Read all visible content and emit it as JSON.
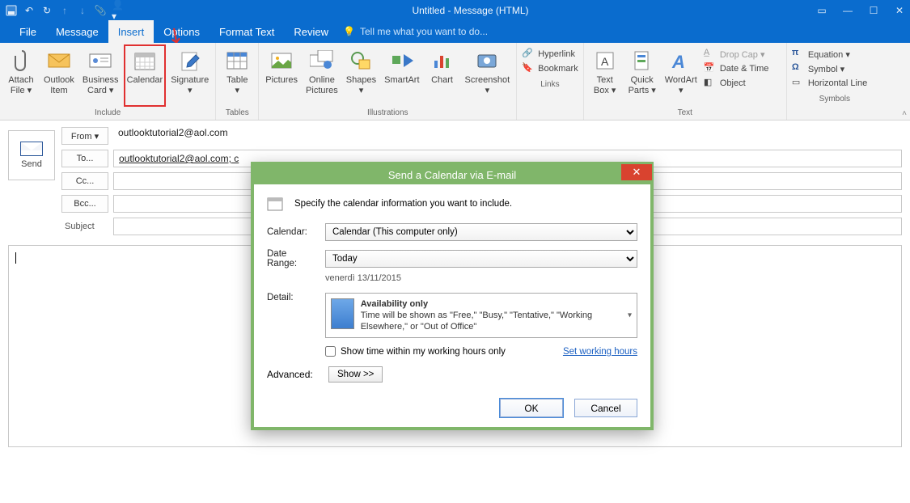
{
  "window": {
    "title": "Untitled - Message (HTML)"
  },
  "menubar": {
    "file": "File",
    "message": "Message",
    "insert": "Insert",
    "options": "Options",
    "format": "Format Text",
    "review": "Review",
    "tell": "Tell me what you want to do..."
  },
  "ribbon": {
    "include": {
      "label": "Include",
      "attach_file": "Attach\nFile ▾",
      "outlook_item": "Outlook\nItem",
      "business_card": "Business\nCard ▾",
      "calendar": "Calendar",
      "signature": "Signature\n▾"
    },
    "tables": {
      "label": "Tables",
      "table": "Table\n▾"
    },
    "illustrations": {
      "label": "Illustrations",
      "pictures": "Pictures",
      "online_pictures": "Online\nPictures",
      "shapes": "Shapes\n▾",
      "smartart": "SmartArt",
      "chart": "Chart",
      "screenshot": "Screenshot\n▾"
    },
    "links": {
      "label": "Links",
      "hyperlink": "Hyperlink",
      "bookmark": "Bookmark"
    },
    "text": {
      "label": "Text",
      "textbox": "Text\nBox ▾",
      "quick_parts": "Quick\nParts ▾",
      "wordart": "WordArt\n▾",
      "drop_cap": "Drop Cap ▾",
      "date_time": "Date & Time",
      "object": "Object"
    },
    "symbols": {
      "label": "Symbols",
      "equation": "Equation ▾",
      "symbol": "Symbol ▾",
      "hline": "Horizontal Line"
    }
  },
  "compose": {
    "send": "Send",
    "from": "From ▾",
    "to": "To...",
    "cc": "Cc...",
    "bcc": "Bcc...",
    "subject_label": "Subject",
    "from_value": "outlooktutorial2@aol.com",
    "to_value": "outlooktutorial2@aol.com; c"
  },
  "dialog": {
    "title": "Send a Calendar via E-mail",
    "intro": "Specify the calendar information you want to include.",
    "calendar_label": "Calendar:",
    "calendar_value": "Calendar (This computer only)",
    "date_range_label": "Date Range:",
    "date_range_value": "Today",
    "date_text": "venerdì 13/11/2015",
    "detail_label": "Detail:",
    "detail_title": "Availability only",
    "detail_desc": "Time will be shown as \"Free,\" \"Busy,\" \"Tentative,\" \"Working Elsewhere,\" or \"Out of Office\"",
    "working_hours_chk": "Show time within my working hours only",
    "set_working_hours": "Set working hours",
    "advanced_label": "Advanced:",
    "show_btn": "Show >>",
    "ok": "OK",
    "cancel": "Cancel"
  }
}
